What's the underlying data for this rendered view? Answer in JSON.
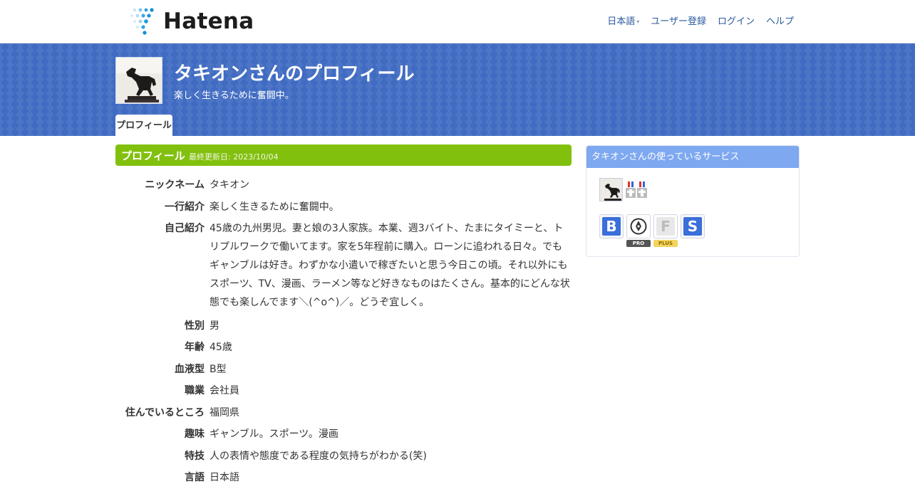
{
  "header": {
    "logo_text": "Hatena",
    "nav": [
      {
        "label": "日本語",
        "has_caret": true
      },
      {
        "label": "ユーザー登録"
      },
      {
        "label": "ログイン"
      },
      {
        "label": "ヘルプ"
      }
    ]
  },
  "banner": {
    "title": "タキオンさんのプロフィール",
    "subtitle": "楽しく生きるために奮闘中。",
    "tab_label": "プロフィール"
  },
  "profile": {
    "section_title": "プロフィール",
    "updated": "最終更新日: 2023/10/04",
    "rows": [
      {
        "key": "ニックネーム",
        "value": "タキオン"
      },
      {
        "key": "一行紹介",
        "value": "楽しく生きるために奮闘中。"
      },
      {
        "key": "自己紹介",
        "value": "45歳の九州男児。妻と娘の3人家族。本業、週3バイト、たまにタイミーと、トリプルワークで働いてます。家を5年程前に購入。ローンに追われる日々。でもギャンブルは好き。わずかな小遣いで稼ぎたいと思う今日この頃。それ以外にもスポーツ、TV、漫画、ラーメン等など好きなものはたくさん。基本的にどんな状態でも楽しんでます＼(^o^)／。どうぞ宜しく。"
      },
      {
        "key": "性別",
        "value": "男"
      },
      {
        "key": "年齢",
        "value": "45歳"
      },
      {
        "key": "血液型",
        "value": "B型"
      },
      {
        "key": "職業",
        "value": "会社員"
      },
      {
        "key": "住んでいるところ",
        "value": "福岡県"
      },
      {
        "key": "趣味",
        "value": "ギャンブル。スポーツ。漫画"
      },
      {
        "key": "特技",
        "value": "人の表情や態度である程度の気持ちがわかる(笑)"
      },
      {
        "key": "言語",
        "value": "日本語"
      }
    ]
  },
  "sidebar": {
    "title": "タキオンさんの使っているサービス",
    "services": [
      {
        "icon": "bookmark-icon",
        "letter": "B",
        "color": "#3b6fd9"
      },
      {
        "icon": "blog-icon",
        "letter": "",
        "color": "#ffffff",
        "badge": "PRO"
      },
      {
        "icon": "fotolife-icon",
        "letter": "F",
        "color": "#e8e8e8",
        "badge": "PLUS"
      },
      {
        "icon": "star-icon",
        "letter": "S",
        "color": "#3b6fd9"
      }
    ],
    "badge_colors": {
      "pro": "#555555",
      "plus": "#f4d35e"
    }
  },
  "colors": {
    "banner": "#3f6bc2",
    "section": "#82c00e",
    "sidebar_head": "#7ea8f0",
    "link": "#2a5a9e"
  }
}
